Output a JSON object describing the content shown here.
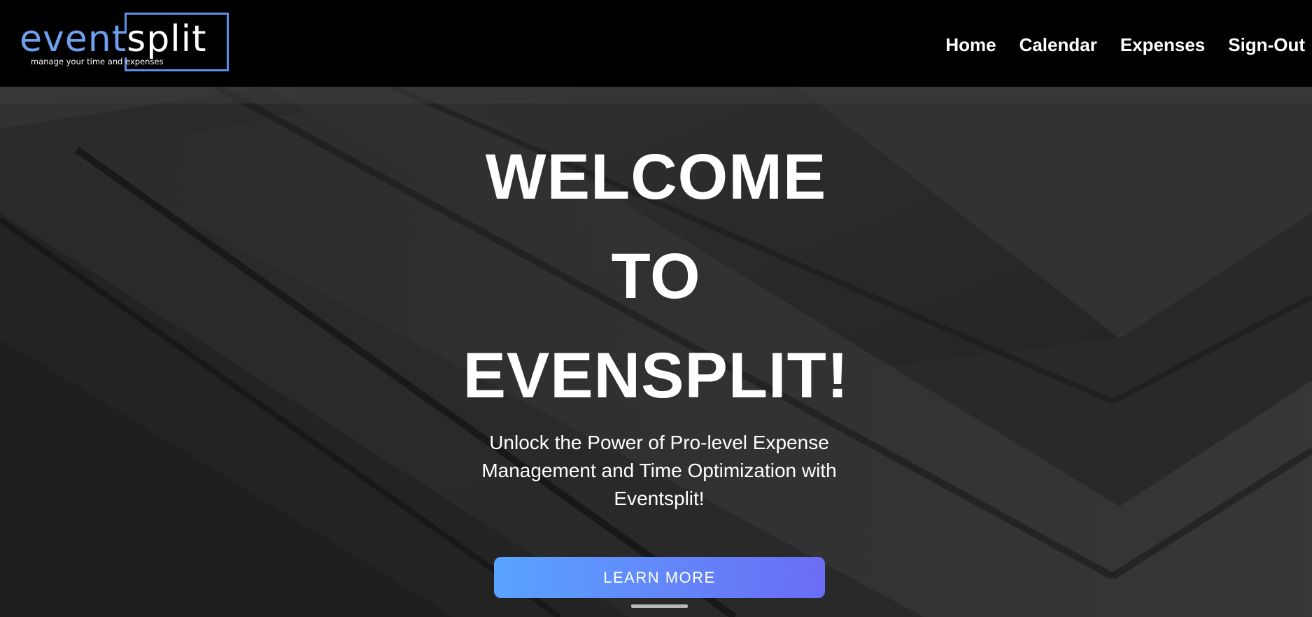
{
  "brand": {
    "word_event": "event",
    "word_split": "split",
    "tagline": "manage your time and expenses",
    "accent_color": "#5b8fe8"
  },
  "nav": {
    "items": [
      {
        "label": "Home"
      },
      {
        "label": "Calendar"
      },
      {
        "label": "Expenses"
      },
      {
        "label": "Sign-Out"
      }
    ]
  },
  "hero": {
    "headline_lines": [
      "WELCOME",
      "TO",
      "EVENSPLIT!"
    ],
    "subtitle": "Unlock the Power of Pro-level Expense Management and Time Optimization with Eventsplit!",
    "cta_label": "LEARN MORE",
    "cta_gradient": [
      "#5aa3ff",
      "#6a6df5"
    ]
  }
}
